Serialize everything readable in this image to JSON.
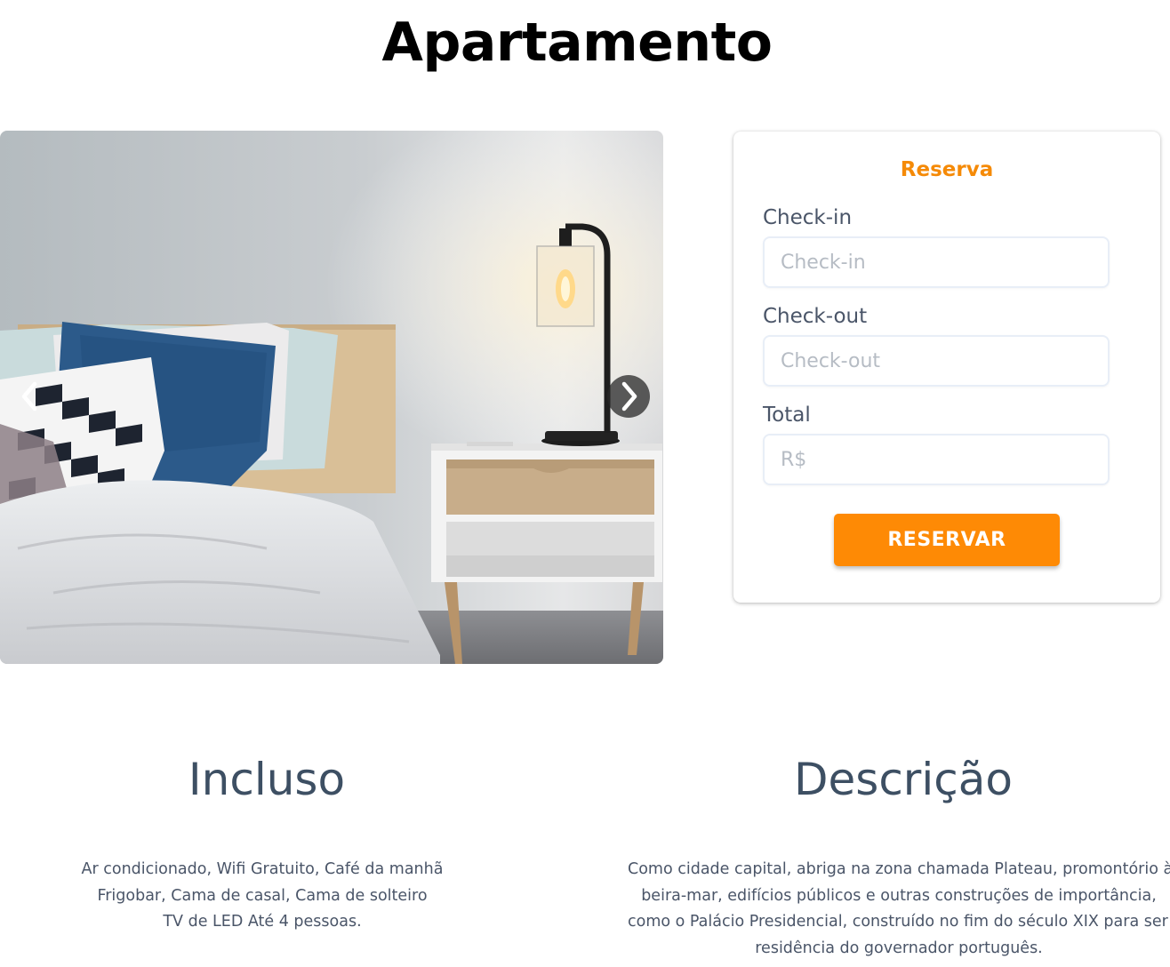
{
  "page": {
    "title": "Apartamento"
  },
  "carousel": {
    "prev_icon": "chevron-left-icon",
    "next_icon": "chevron-right-icon"
  },
  "reservation": {
    "title": "Reserva",
    "checkin_label": "Check-in",
    "checkin_placeholder": "Check-in",
    "checkout_label": "Check-out",
    "checkout_placeholder": "Check-out",
    "total_label": "Total",
    "total_placeholder": "R$",
    "button_label": "RESERVAR",
    "accent_color": "#FE8A05"
  },
  "included": {
    "title": "Incluso",
    "lines": [
      "Ar condicionado, Wifi Gratuito, Café da manhã",
      "Frigobar, Cama de casal, Cama de solteiro",
      "TV de LED Até 4 pessoas."
    ]
  },
  "description": {
    "title": "Descrição",
    "lines": [
      "Como cidade capital, abriga na zona chamada Plateau, promontório à",
      "beira-mar, edifícios públicos e outras construções de importância,",
      "como o Palácio Presidencial, construído no fim do século XIX para ser a",
      "residência do governador português."
    ]
  }
}
